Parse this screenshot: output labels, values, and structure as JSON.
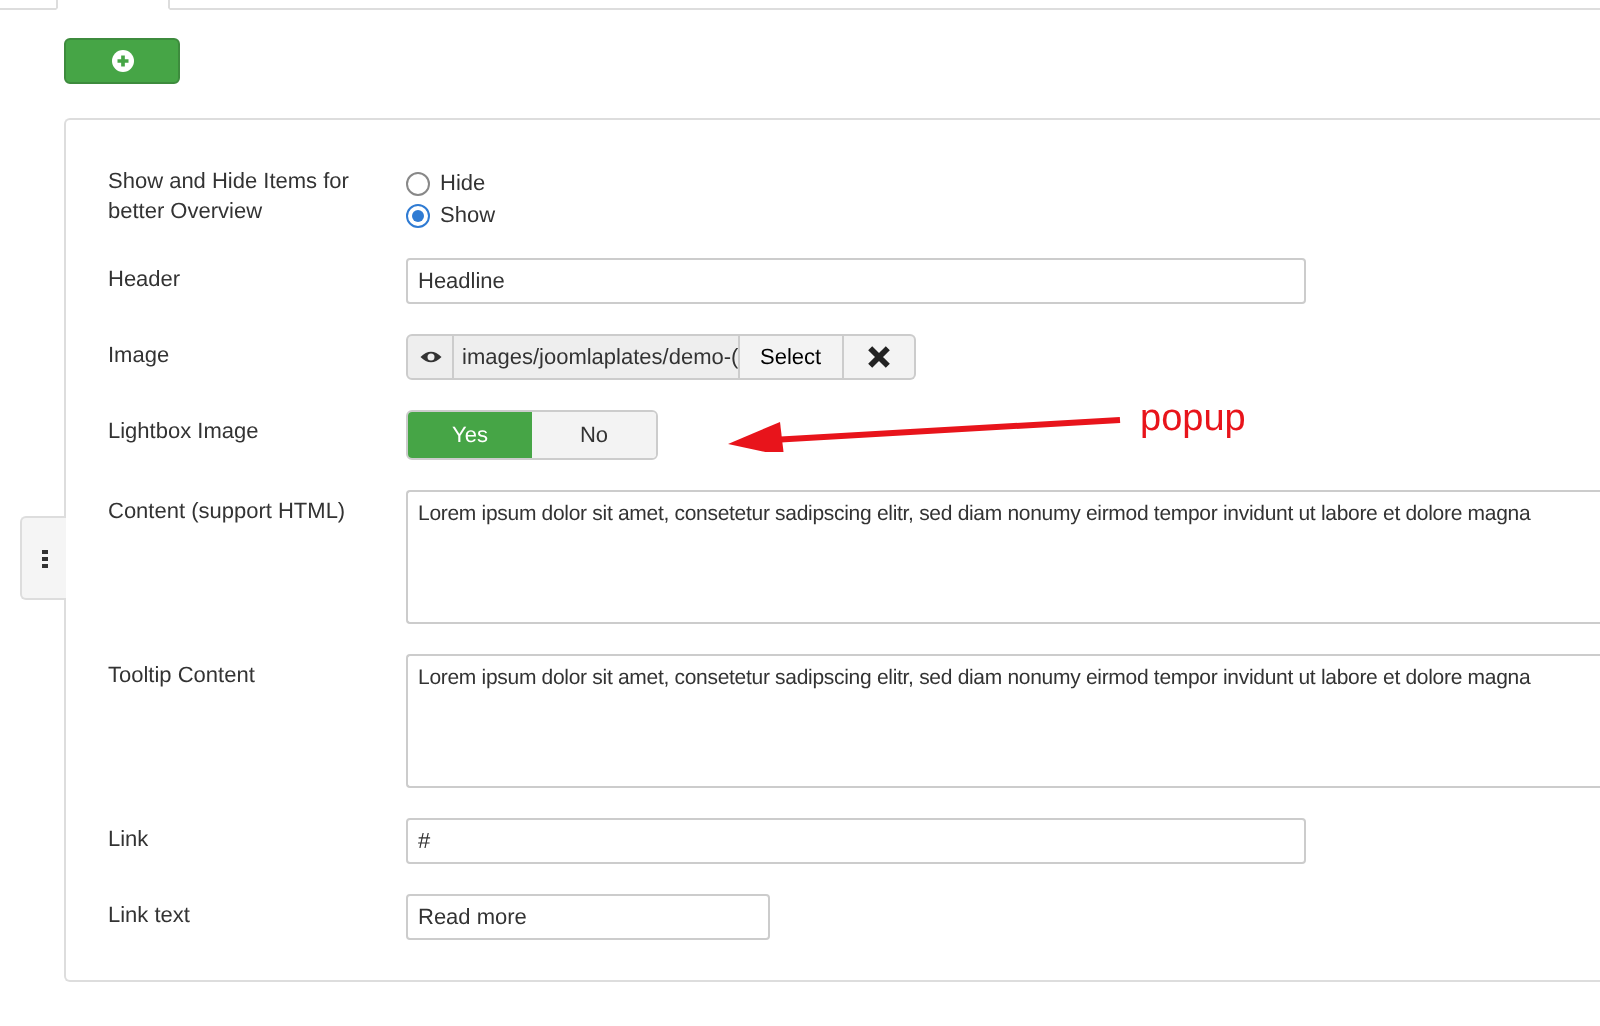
{
  "fields": [
    {
      "kind": "radio",
      "label": "Show and Hide Items for better Overview",
      "options": [
        {
          "label": "Hide",
          "selected": false
        },
        {
          "label": "Show",
          "selected": true
        }
      ]
    },
    {
      "kind": "text",
      "label": "Header",
      "value": "Headline"
    },
    {
      "kind": "media",
      "label": "Image",
      "value": "images/joomlaplates/demo-(",
      "button": "Select"
    },
    {
      "kind": "toggle",
      "label": "Lightbox Image",
      "options": [
        {
          "label": "Yes",
          "selected": true
        },
        {
          "label": "No",
          "selected": false
        }
      ]
    },
    {
      "kind": "textarea",
      "label": "Content (support HTML)",
      "value": "Lorem ipsum dolor sit amet, consetetur sadipscing elitr, sed diam nonumy eirmod tempor invidunt ut labore et dolore magna"
    },
    {
      "kind": "textarea",
      "label": "Tooltip Content",
      "value": "Lorem ipsum dolor sit amet, consetetur sadipscing elitr, sed diam nonumy eirmod tempor invidunt ut labore et dolore magna"
    },
    {
      "kind": "text",
      "label": "Link",
      "value": "#"
    },
    {
      "kind": "short_text",
      "label": "Link text",
      "value": "Read more"
    }
  ],
  "annotation": {
    "text": "popup"
  }
}
